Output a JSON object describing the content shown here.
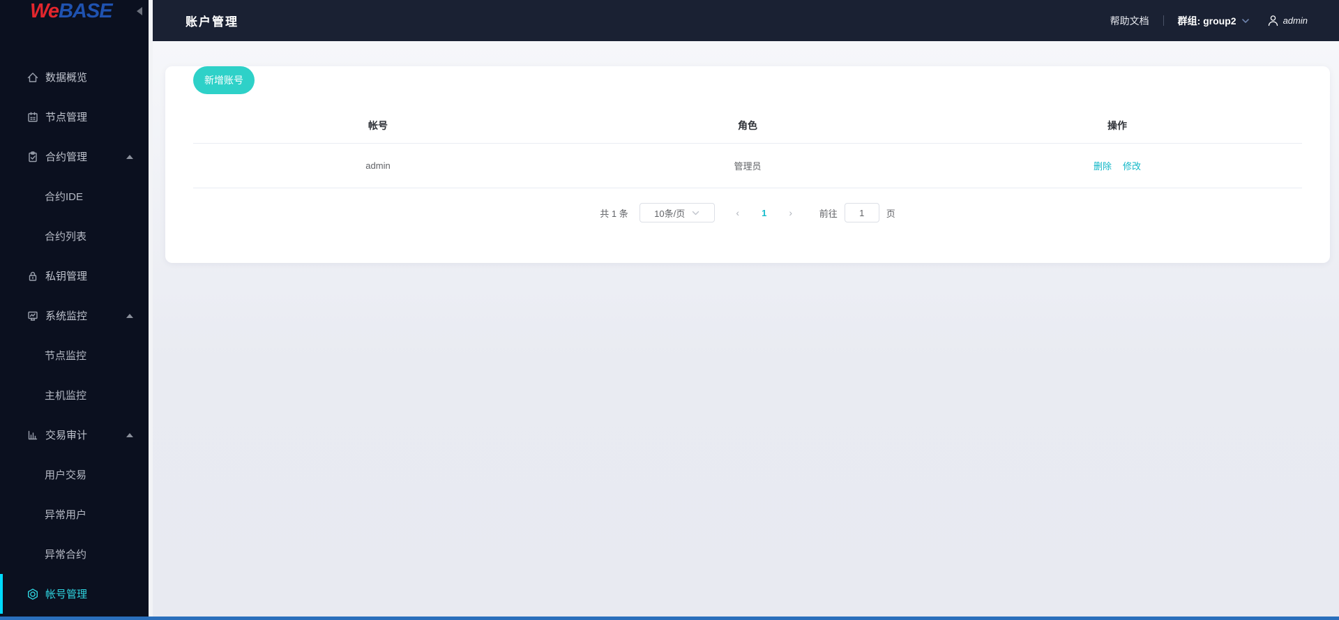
{
  "brand": {
    "logo_we": "We",
    "logo_base": "BASE"
  },
  "sidebar": {
    "items": [
      {
        "label": "数据概览",
        "icon": "home-icon",
        "type": "top"
      },
      {
        "label": "节点管理",
        "icon": "calendar-icon",
        "type": "top"
      },
      {
        "label": "合约管理",
        "icon": "clipboard-icon",
        "type": "top",
        "expanded": true
      },
      {
        "label": "合约IDE",
        "type": "sub"
      },
      {
        "label": "合约列表",
        "type": "sub"
      },
      {
        "label": "私钥管理",
        "icon": "lock-icon",
        "type": "top"
      },
      {
        "label": "系统监控",
        "icon": "monitor-icon",
        "type": "top",
        "expanded": true
      },
      {
        "label": "节点监控",
        "type": "sub"
      },
      {
        "label": "主机监控",
        "type": "sub"
      },
      {
        "label": "交易审计",
        "icon": "bar-chart-icon",
        "type": "top",
        "expanded": true
      },
      {
        "label": "用户交易",
        "type": "sub"
      },
      {
        "label": "异常用户",
        "type": "sub"
      },
      {
        "label": "异常合约",
        "type": "sub"
      },
      {
        "label": "帐号管理",
        "icon": "hexagon-badge-icon",
        "type": "top",
        "active": true
      }
    ]
  },
  "header": {
    "title": "账户管理",
    "help_label": "帮助文档",
    "group_label": "群组: group2",
    "user_name": "admin"
  },
  "main": {
    "add_button_label": "新增账号",
    "table": {
      "columns": [
        "帐号",
        "角色",
        "操作"
      ],
      "rows": [
        {
          "account": "admin",
          "role": "管理员",
          "actions": [
            "删除",
            "修改"
          ]
        }
      ]
    },
    "pagination": {
      "total_text": "共 1 条",
      "page_size_text": "10条/页",
      "prev_symbol": "‹",
      "current_page": "1",
      "next_symbol": "›",
      "goto_label": "前往",
      "goto_value": "1",
      "page_suffix": "页"
    }
  },
  "colors": {
    "sidebar_bg": "#0b101f",
    "topbar_bg": "#1a2133",
    "accent_teal": "#2ed1c8",
    "link_teal": "#10b7c7",
    "active_cyan": "#2fd6e2",
    "active_bar": "#00dbff",
    "logo_red": "#e3262d",
    "logo_blue": "#1f52b0",
    "bottom_strip_blue": "#2a6fbc"
  }
}
